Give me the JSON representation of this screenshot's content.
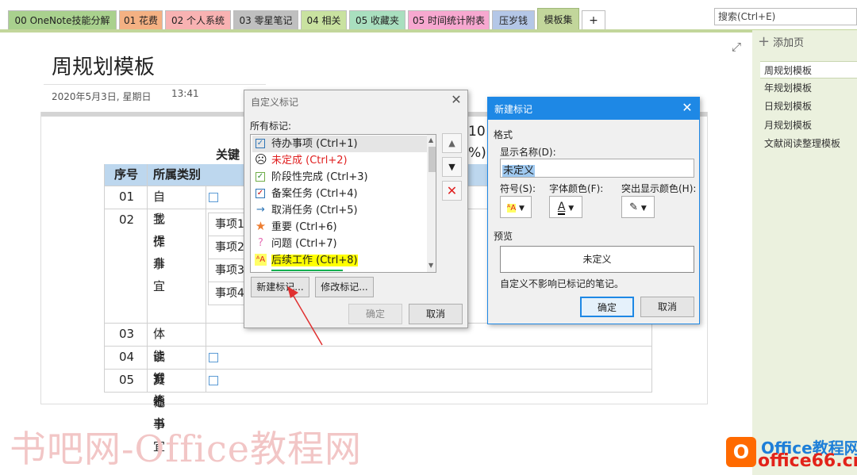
{
  "tabs": [
    {
      "label": "00 OneNote技能分解",
      "color": "#a9d18e"
    },
    {
      "label": "01 花费",
      "color": "#f4b183"
    },
    {
      "label": "02 个人系统",
      "color": "#f8b2b2"
    },
    {
      "label": "03 零星笔记",
      "color": "#bfbfbf"
    },
    {
      "label": "04 相关",
      "color": "#c9e2a0"
    },
    {
      "label": "05 收藏夹",
      "color": "#a9dfbf"
    },
    {
      "label": "05 时间统计附表",
      "color": "#f7a8d0"
    },
    {
      "label": "压岁钱",
      "color": "#b4c7e7"
    },
    {
      "label": "模板集",
      "color": "#c2d69b"
    },
    {
      "label": "+",
      "color": "#ffffff"
    }
  ],
  "search": {
    "placeholder": "搜索(Ctrl+E)"
  },
  "right_panel": {
    "add_page": "添加页",
    "pages": [
      "周规划模板",
      "年规划模板",
      "日规划模板",
      "月规划模板",
      "文献阅读整理模板"
    ]
  },
  "page": {
    "title": "周规划模板",
    "date": "2020年5月3日, 星期日",
    "time": "13:41",
    "key_label": "关键",
    "partial_number": "10",
    "partial_percent": "%)",
    "table": {
      "headers": [
        "序号",
        "所属类别"
      ],
      "rows": [
        {
          "num": "01",
          "cat": "自我提升"
        },
        {
          "num": "02",
          "cat": "工作事宜",
          "subs": [
            "事项1",
            "事项2",
            "事项3",
            "事项4"
          ]
        },
        {
          "num": "03",
          "cat": "体能锻炼"
        },
        {
          "num": "04",
          "cat": "读万卷书"
        },
        {
          "num": "05",
          "cat": "其他事宜"
        }
      ]
    }
  },
  "dialog_custom_tags": {
    "title": "自定义标记",
    "all_tags_label": "所有标记:",
    "tags": [
      {
        "label": "待办事项 (Ctrl+1)",
        "icon": "checkbox-icon",
        "color": "#222"
      },
      {
        "label": "未定成 (Ctrl+2)",
        "icon": "sad-face-icon",
        "color": "#e02020"
      },
      {
        "label": "阶段性完成 (Ctrl+3)",
        "icon": "checkbox-checked-icon",
        "color": "#222"
      },
      {
        "label": "备案任务 (Ctrl+4)",
        "icon": "checkbox-checked-blue-icon",
        "color": "#222"
      },
      {
        "label": "取消任务 (Ctrl+5)",
        "icon": "arrow-right-icon",
        "color": "#222"
      },
      {
        "label": "重要 (Ctrl+6)",
        "icon": "star-icon",
        "color": "#222"
      },
      {
        "label": "问题 (Ctrl+7)",
        "icon": "question-icon",
        "color": "#222"
      },
      {
        "label": "后续工作 (Ctrl+8)",
        "icon": "highlight-a-icon",
        "color": "#222",
        "highlight": "#ffff00"
      }
    ],
    "new_tag_button": "新建标记...",
    "modify_tag_button": "修改标记...",
    "ok_button": "确定",
    "cancel_button": "取消"
  },
  "dialog_new_tag": {
    "title": "新建标记",
    "format_label": "格式",
    "display_name_label": "显示名称(D):",
    "display_name_value": "未定义",
    "symbol_label": "符号(S):",
    "font_color_label": "字体颜色(F):",
    "highlight_color_label": "突出显示颜色(H):",
    "preview_label": "预览",
    "preview_text": "未定义",
    "note": "自定义不影响已标记的笔记。",
    "ok_button": "确定",
    "cancel_button": "取消"
  },
  "watermark": {
    "text": "书吧网-Office教程网"
  },
  "logo": {
    "line1": "Office教程网",
    "line2": "office66.cn"
  }
}
